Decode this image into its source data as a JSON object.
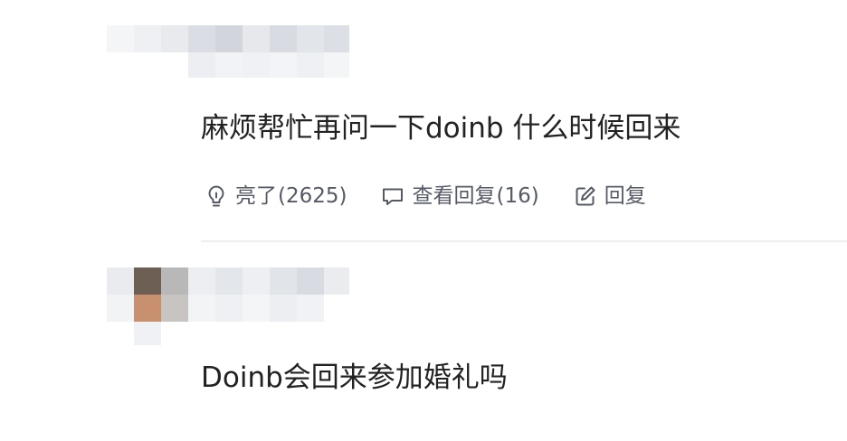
{
  "comments": [
    {
      "text": "麻烦帮忙再问一下doinb 什么时候回来",
      "actions": {
        "like": {
          "icon": "lightbulb-icon",
          "label": "亮了",
          "count": "(2625)"
        },
        "view_replies": {
          "icon": "comment-bubble-icon",
          "label": "查看回复",
          "count": "(16)"
        },
        "reply": {
          "icon": "edit-icon",
          "label": "回复"
        }
      }
    },
    {
      "text": "Doinb会回来参加婚礼吗"
    }
  ],
  "colors": {
    "text": "#222222",
    "action_text": "#555a64",
    "divider": "#eeeeee",
    "background": "#ffffff"
  }
}
